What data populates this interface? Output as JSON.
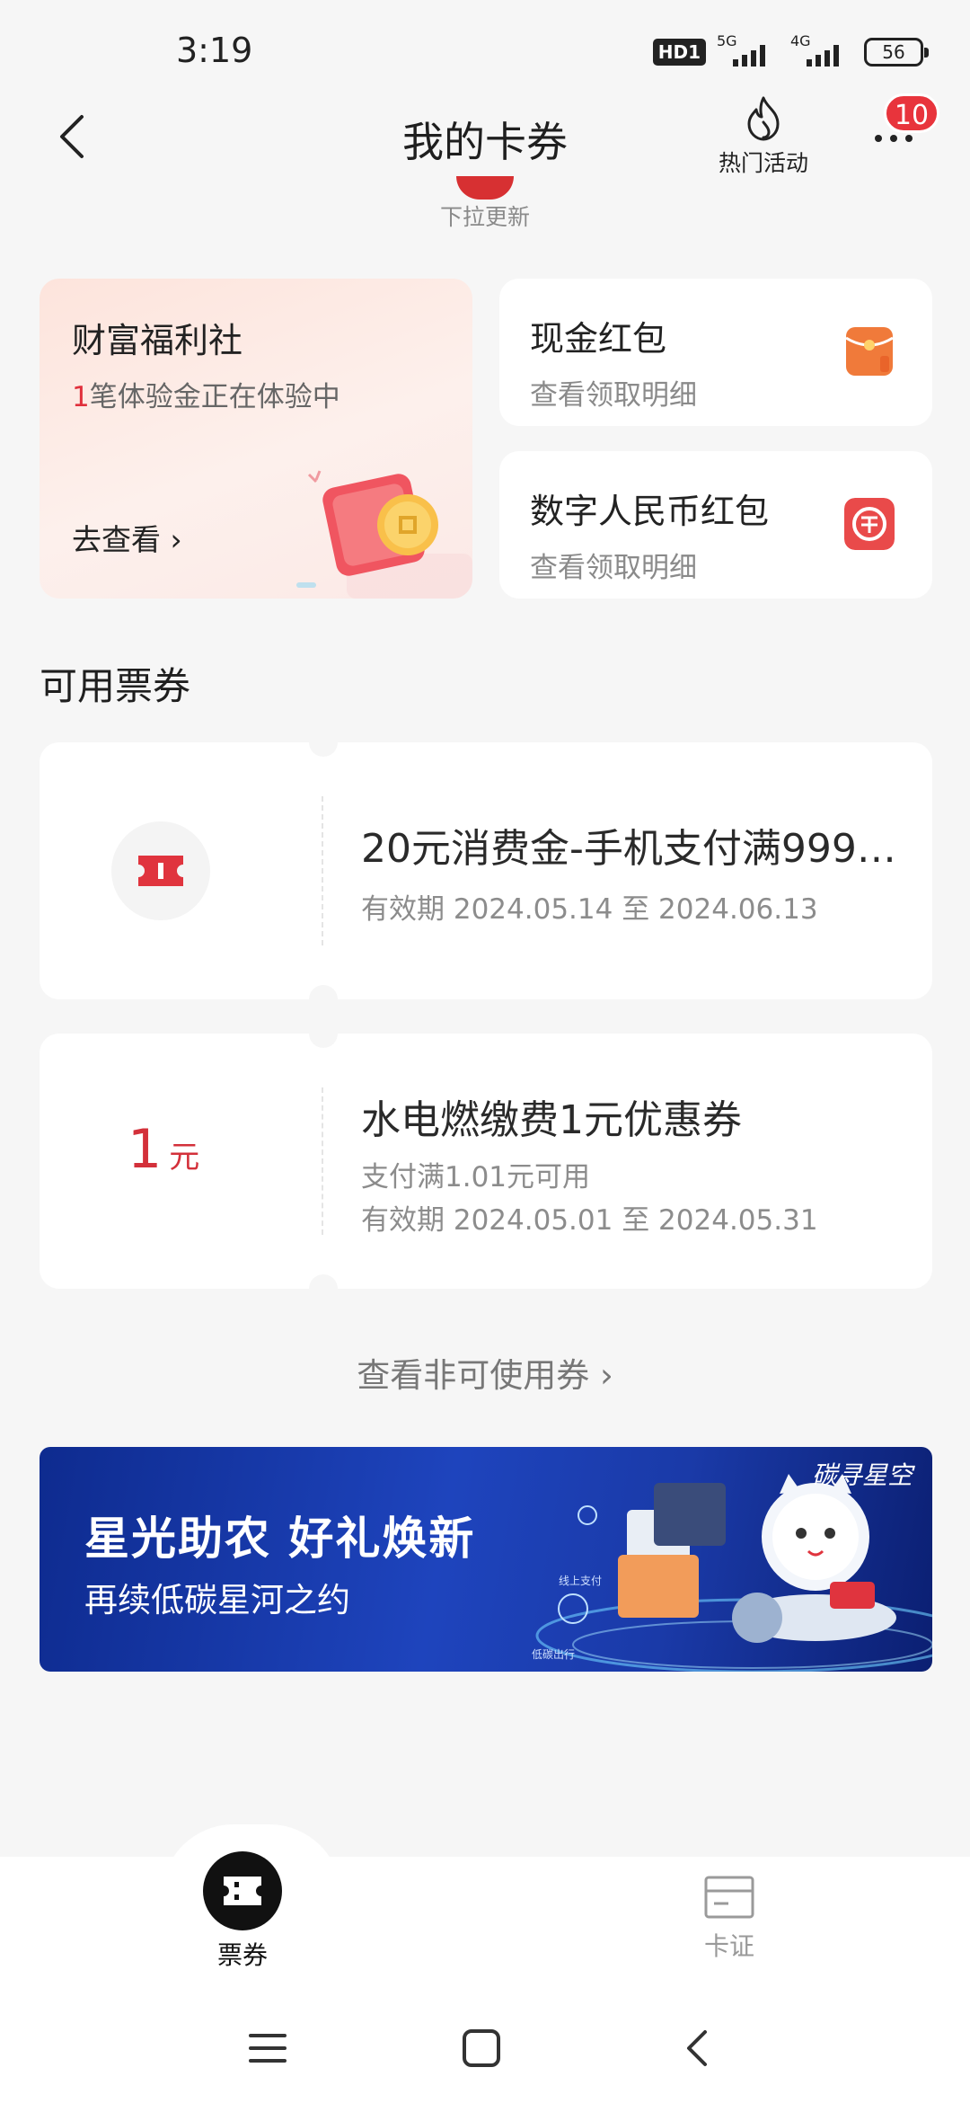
{
  "status_bar": {
    "time": "3:19",
    "hd": "HD1",
    "net1": "5G",
    "net2": "4G",
    "battery": "56"
  },
  "nav": {
    "title": "我的卡券",
    "hot_activity": "热门活动",
    "more_badge": "10"
  },
  "pull_refresh": "下拉更新",
  "welfare": {
    "title": "财富福利社",
    "sub_num": "1",
    "sub_text": "笔体验金正在体验中",
    "link": "去查看 ›"
  },
  "cash_red_packet": {
    "title": "现金红包",
    "sub": "查看领取明细",
    "color": "#f07a3a"
  },
  "dcep_red_packet": {
    "title": "数字人民币红包",
    "sub": "查看领取明细",
    "color": "#e94a4a"
  },
  "section_title": "可用票券",
  "coupons": [
    {
      "title": "20元消费金-手机支付满999…",
      "validity": "有效期 2024.05.14 至 2024.06.13"
    },
    {
      "amount": "1",
      "unit": "元",
      "title": "水电燃缴费1元优惠券",
      "condition": "支付满1.01元可用",
      "validity": "有效期 2024.05.01 至 2024.05.31"
    }
  ],
  "view_unusable": "查看非可使用券 ›",
  "banner": {
    "headline": "星光助农  好礼焕新",
    "subline": "再续低碳星河之约",
    "brand": "碳寻星空",
    "tag1": "线上支付",
    "tag2": "低碳出行"
  },
  "tabs": [
    {
      "label": "票券"
    },
    {
      "label": "卡证"
    }
  ],
  "accent": "#e0303c"
}
